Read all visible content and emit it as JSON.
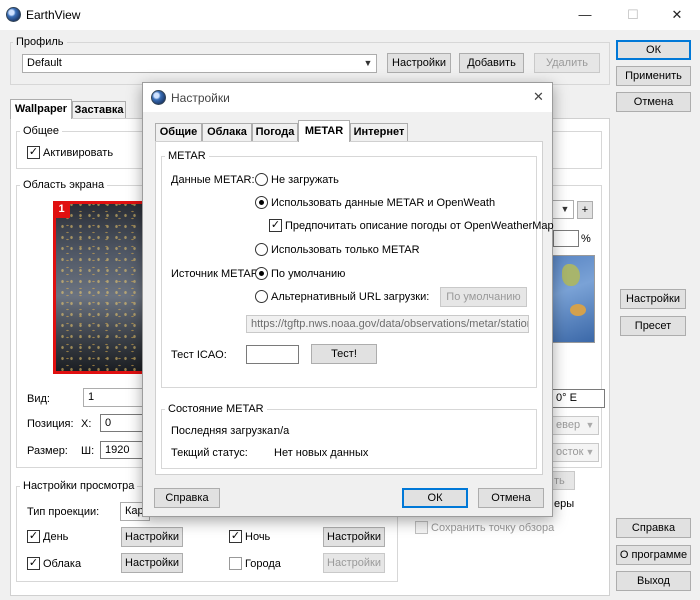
{
  "window": {
    "title": "EarthView",
    "minimize": "—",
    "maximize": "☐",
    "close": "✕"
  },
  "profile": {
    "group_label": "Профиль",
    "value": "Default",
    "settings_btn": "Настройки",
    "add_btn": "Добавить",
    "delete_btn": "Удалить"
  },
  "right_buttons": {
    "ok": "ОК",
    "apply": "Применить",
    "cancel": "Отмена",
    "settings": "Настройки",
    "preset": "Пресет",
    "help": "Справка",
    "about": "О программе",
    "exit": "Выход"
  },
  "main_tabs": [
    {
      "label": "Wallpaper"
    },
    {
      "label": "Заставка"
    }
  ],
  "general": {
    "label": "Общее",
    "activate": "Активировать"
  },
  "screen_area": {
    "label": "Область экрана",
    "monitor_number": "1",
    "view_label": "Вид:",
    "view_value": "1",
    "position_label": "Позиция:",
    "x_label": "X:",
    "x_value": "0",
    "size_label": "Размер:",
    "w_label": "Ш:",
    "w_value": "1920",
    "percent": "%",
    "plus": "+",
    "coord_value": "0° E",
    "dir1": "евер",
    "dir2": "осток",
    "fragment1": "ть",
    "fragment2": "еры",
    "save_view": "Сохранить точку обзора"
  },
  "view_settings": {
    "label": "Настройки просмотра",
    "projection_label": "Тип проекции:",
    "projection_value": "Карт",
    "day": "День",
    "night": "Ночь",
    "clouds": "Облака",
    "cities": "Города",
    "settings_btn": "Настройки"
  },
  "dialog": {
    "title": "Настройки",
    "close": "✕",
    "tabs": [
      {
        "label": "Общие"
      },
      {
        "label": "Облака"
      },
      {
        "label": "Погода"
      },
      {
        "label": "METAR"
      },
      {
        "label": "Интернет"
      }
    ],
    "metar": {
      "group_label": "METAR",
      "data_label": "Данные METAR:",
      "opt_none": "Не загружать",
      "opt_both": "Использовать данные METAR и OpenWeath",
      "prefer_owm": "Предпочитать описание погоды от OpenWeatherMap",
      "opt_only": "Использовать только METAR",
      "source_label": "Источник METAR:",
      "src_default": "По умолчанию",
      "src_alt": "Альтернативный URL загрузки:",
      "default_btn": "По умолчанию",
      "url_value": "https://tgftp.nws.noaa.gov/data/observations/metar/stations/",
      "icao_label": "Тест ICAO:",
      "icao_value": "",
      "test_btn": "Тест!"
    },
    "status": {
      "group_label": "Состояние METAR",
      "last_label": "Последняя загрузка:",
      "last_value": "n/a",
      "current_label": "Текщий статус:",
      "current_value": "Нет новых данных"
    },
    "help_btn": "Справка",
    "ok_btn": "ОК",
    "cancel_btn": "Отмена"
  }
}
